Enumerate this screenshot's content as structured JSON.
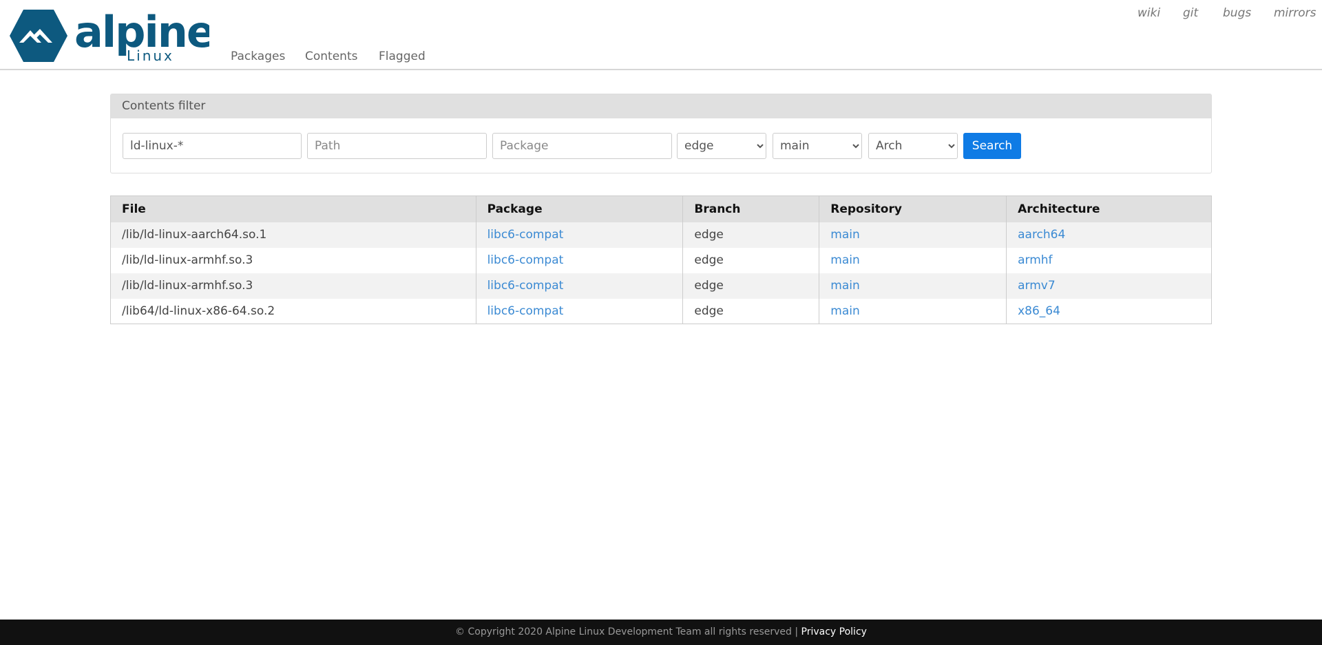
{
  "brand": {
    "name": "alpine",
    "sub": "Linux",
    "color": "#0d597f"
  },
  "nav": [
    {
      "label": "Packages"
    },
    {
      "label": "Contents"
    },
    {
      "label": "Flagged"
    }
  ],
  "top_links": [
    {
      "label": "wiki"
    },
    {
      "label": "git"
    },
    {
      "label": "bugs"
    },
    {
      "label": "mirrors"
    }
  ],
  "filter": {
    "title": "Contents filter",
    "file_value": "ld-linux-*",
    "path_placeholder": "Path",
    "package_placeholder": "Package",
    "branch": "edge",
    "repo": "main",
    "arch": "Arch",
    "search_label": "Search"
  },
  "table": {
    "headers": [
      "File",
      "Package",
      "Branch",
      "Repository",
      "Architecture"
    ],
    "rows": [
      [
        "/lib/ld-linux-aarch64.so.1",
        "libc6-compat",
        "edge",
        "main",
        "aarch64"
      ],
      [
        "/lib/ld-linux-armhf.so.3",
        "libc6-compat",
        "edge",
        "main",
        "armhf"
      ],
      [
        "/lib/ld-linux-armhf.so.3",
        "libc6-compat",
        "edge",
        "main",
        "armv7"
      ],
      [
        "/lib64/ld-linux-x86-64.so.2",
        "libc6-compat",
        "edge",
        "main",
        "x86_64"
      ]
    ]
  },
  "footer": {
    "copyright": "© Copyright 2020 Alpine Linux Development Team all rights reserved | ",
    "privacy": "Privacy Policy"
  }
}
